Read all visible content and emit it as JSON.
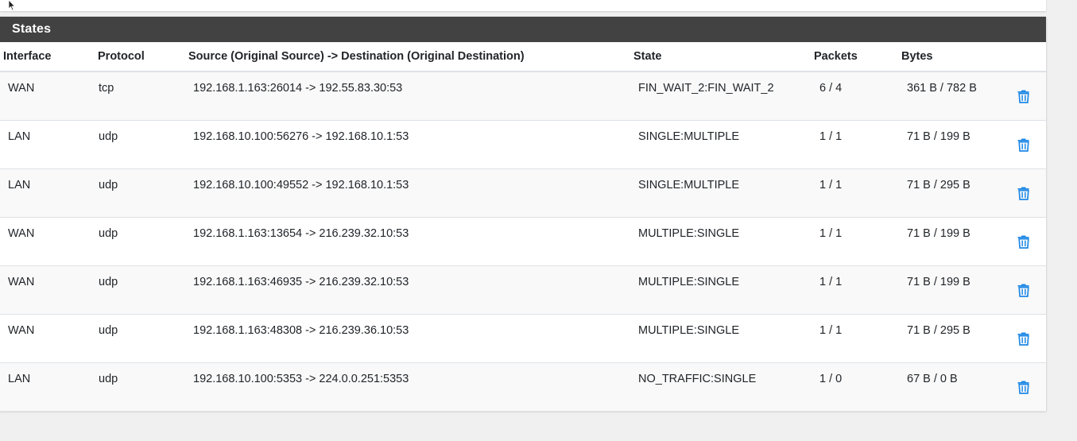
{
  "panel": {
    "title": "States"
  },
  "columns": {
    "interface": "Interface",
    "protocol": "Protocol",
    "source_destination": "Source (Original Source) -> Destination (Original Destination)",
    "state": "State",
    "packets": "Packets",
    "bytes": "Bytes"
  },
  "rows": [
    {
      "interface": "WAN",
      "protocol": "tcp",
      "source_destination": "192.168.1.163:26014 -> 192.55.83.30:53",
      "state": "FIN_WAIT_2:FIN_WAIT_2",
      "packets": "6 / 4",
      "bytes": "361 B / 782 B"
    },
    {
      "interface": "LAN",
      "protocol": "udp",
      "source_destination": "192.168.10.100:56276 -> 192.168.10.1:53",
      "state": "SINGLE:MULTIPLE",
      "packets": "1 / 1",
      "bytes": "71 B / 199 B"
    },
    {
      "interface": "LAN",
      "protocol": "udp",
      "source_destination": "192.168.10.100:49552 -> 192.168.10.1:53",
      "state": "SINGLE:MULTIPLE",
      "packets": "1 / 1",
      "bytes": "71 B / 295 B"
    },
    {
      "interface": "WAN",
      "protocol": "udp",
      "source_destination": "192.168.1.163:13654 -> 216.239.32.10:53",
      "state": "MULTIPLE:SINGLE",
      "packets": "1 / 1",
      "bytes": "71 B / 199 B"
    },
    {
      "interface": "WAN",
      "protocol": "udp",
      "source_destination": "192.168.1.163:46935 -> 216.239.32.10:53",
      "state": "MULTIPLE:SINGLE",
      "packets": "1 / 1",
      "bytes": "71 B / 199 B"
    },
    {
      "interface": "WAN",
      "protocol": "udp",
      "source_destination": "192.168.1.163:48308 -> 216.239.36.10:53",
      "state": "MULTIPLE:SINGLE",
      "packets": "1 / 1",
      "bytes": "71 B / 295 B"
    },
    {
      "interface": "LAN",
      "protocol": "udp",
      "source_destination": "192.168.10.100:5353 -> 224.0.0.251:5353",
      "state": "NO_TRAFFIC:SINGLE",
      "packets": "1 / 0",
      "bytes": "67 B / 0 B"
    }
  ],
  "icons": {
    "row_action": "trash-icon",
    "pointer": "mouse-cursor-icon"
  },
  "colors": {
    "heading_bg": "#424242",
    "trash_icon": "#1e88e5",
    "row_stripe": "#f9f9f9"
  }
}
